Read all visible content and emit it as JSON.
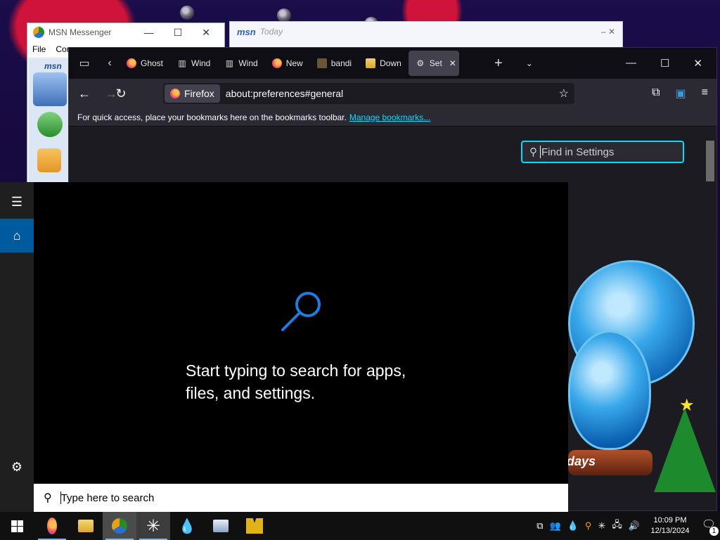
{
  "msn_messenger": {
    "title": "MSN Messenger",
    "menu": [
      "File",
      "Con"
    ],
    "logo_text": "msn"
  },
  "msn_today": {
    "logo_text": "msn",
    "title": "Today"
  },
  "firefox": {
    "tabs": [
      {
        "icon": "firefox-icon",
        "label": "Ghost"
      },
      {
        "icon": "library-icon",
        "label": "Wind"
      },
      {
        "icon": "library-icon",
        "label": "Wind"
      },
      {
        "icon": "firefox-icon",
        "label": "New"
      },
      {
        "icon": "bandicam-icon",
        "label": "bandi"
      },
      {
        "icon": "folder-icon",
        "label": "Down"
      },
      {
        "icon": "gear-icon",
        "label": "Set",
        "active": true
      }
    ],
    "identity_label": "Firefox",
    "url": "about:preferences#general",
    "bookmarks_hint": "For quick access, place your bookmarks here on the bookmarks toolbar.",
    "manage_bookmarks": "Manage bookmarks...",
    "find_placeholder": "Find in Settings"
  },
  "desktop": {
    "countdown_text": "days"
  },
  "start_menu": {
    "hint": "Start typing to search for apps, files, and settings.",
    "search_placeholder": "Type here to search"
  },
  "taskbar": {
    "apps": [
      "firefox",
      "file-explorer",
      "msn-messenger",
      "app-asterisk",
      "droplet-app",
      "control-panel",
      "game-app"
    ],
    "clock_time": "10:09 PM",
    "clock_date": "12/13/2024",
    "notification_count": "1"
  },
  "colors": {
    "accent_blue": "#005a9e",
    "focus_ring": "#00ddff",
    "link": "#00ddff"
  }
}
